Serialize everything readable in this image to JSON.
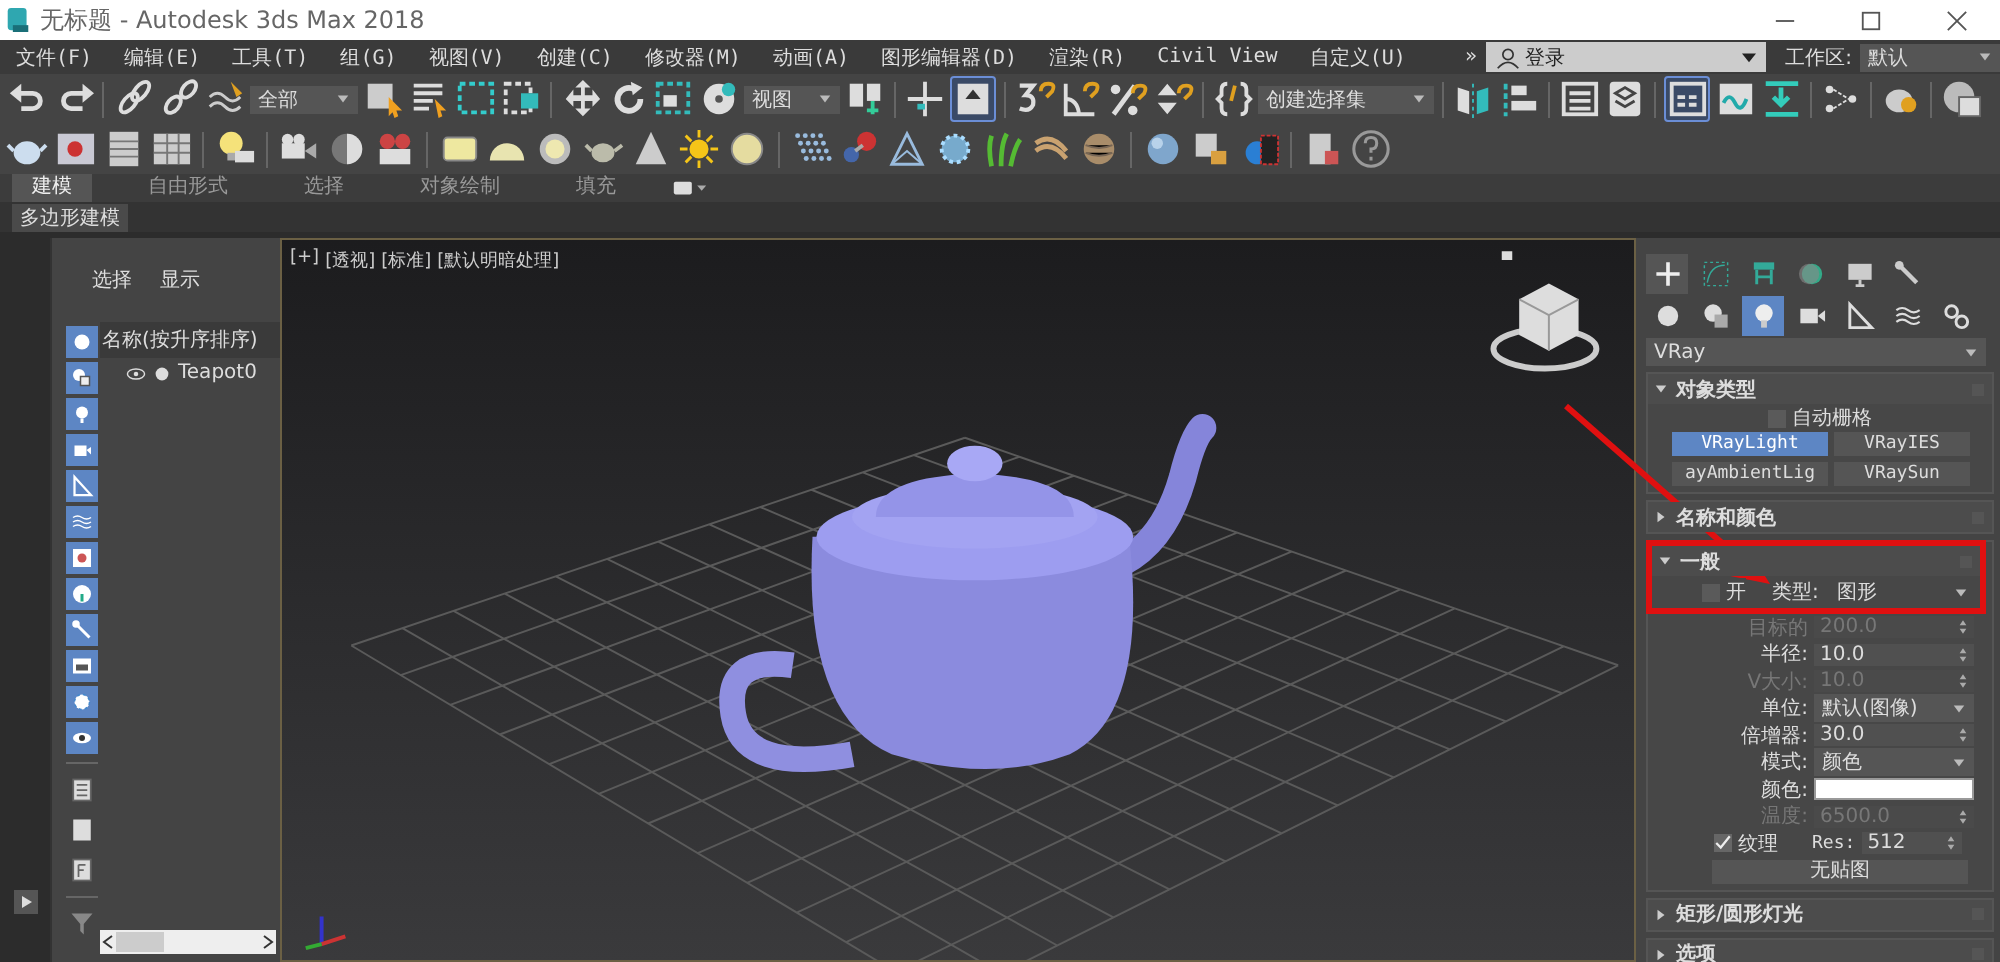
{
  "window": {
    "title": "无标题 - Autodesk 3ds Max 2018"
  },
  "menu": [
    "文件(F)",
    "编辑(E)",
    "工具(T)",
    "组(G)",
    "视图(V)",
    "创建(C)",
    "修改器(M)",
    "动画(A)",
    "图形编辑器(D)",
    "渲染(R)",
    "Civil View",
    "自定义(U)"
  ],
  "menu_overflow": "»",
  "login": {
    "label": "登录"
  },
  "workspace": {
    "label": "工作区:",
    "value": "默认"
  },
  "toolbar": {
    "selection_filter": "全部",
    "reference_coord": "视图",
    "named_selection": "创建选择集"
  },
  "ribbon": {
    "tabs": [
      {
        "label": "建模",
        "selected": true
      },
      {
        "label": "自由形式",
        "selected": false
      },
      {
        "label": "选择",
        "selected": false
      },
      {
        "label": "对象绘制",
        "selected": false
      },
      {
        "label": "填充",
        "selected": false
      }
    ],
    "panel": "多边形建模"
  },
  "scene_explorer": {
    "tabs": [
      "选择",
      "显示"
    ],
    "column": "名称(按升序排序)",
    "items": [
      {
        "name": "Teapot0",
        "visible": true
      }
    ]
  },
  "viewport": {
    "labels": [
      "[+]",
      "[透视]",
      "[标准]",
      "[默认明暗处理]"
    ]
  },
  "command_panel": {
    "tabs": [
      {
        "selected": true
      },
      {
        "selected": false
      },
      {
        "selected": false
      },
      {
        "selected": false
      },
      {
        "selected": false
      },
      {
        "selected": false
      }
    ],
    "categories": [
      {
        "selected": false
      },
      {
        "selected": false
      },
      {
        "selected": true
      },
      {
        "selected": false
      },
      {
        "selected": false
      },
      {
        "selected": false
      },
      {
        "selected": false
      }
    ],
    "renderer": "VRay",
    "rollouts": [
      {
        "kind": "object_type",
        "title": "对象类型",
        "expanded": true,
        "autogrid": {
          "label": "自动栅格",
          "checked": false
        },
        "buttons": [
          {
            "label": "VRayLight",
            "selected": true
          },
          {
            "label": "VRayIES",
            "selected": false
          },
          {
            "label": "ayAmbientLig",
            "selected": false
          },
          {
            "label": "VRaySun",
            "selected": false
          }
        ]
      },
      {
        "kind": "plain",
        "title": "名称和颜色",
        "expanded": false
      },
      {
        "kind": "general",
        "title": "一般",
        "expanded": true,
        "on": {
          "label": "开",
          "checked": false
        },
        "type": {
          "label": "类型:",
          "value": "图形"
        },
        "params": [
          {
            "kind": "spinner",
            "label": "目标的",
            "value": "200.0",
            "disabled": true
          },
          {
            "kind": "spinner",
            "label": "半径:",
            "value": "10.0",
            "disabled": false
          },
          {
            "kind": "spinner",
            "label": "V大小:",
            "value": "10.0",
            "disabled": true
          },
          {
            "kind": "dropdown",
            "label": "单位:",
            "value": "默认(图像)",
            "disabled": false
          },
          {
            "kind": "spinner",
            "label": "倍增器:",
            "value": "30.0",
            "disabled": false
          },
          {
            "kind": "dropdown",
            "label": "模式:",
            "value": "颜色",
            "disabled": false
          },
          {
            "kind": "swatch",
            "label": "颜色:",
            "color": "#ffffff",
            "disabled": false
          },
          {
            "kind": "spinner",
            "label": "温度:",
            "value": "6500.0",
            "disabled": true
          },
          {
            "kind": "texture",
            "label": "纹理",
            "checked": true,
            "res_label": "Res:",
            "value": "512",
            "disabled": false
          },
          {
            "kind": "button",
            "label": "无贴图",
            "disabled": false
          }
        ]
      },
      {
        "kind": "plain",
        "title": "矩形/圆形灯光",
        "expanded": false
      },
      {
        "kind": "plain",
        "title": "选项",
        "expanded": false
      }
    ]
  }
}
